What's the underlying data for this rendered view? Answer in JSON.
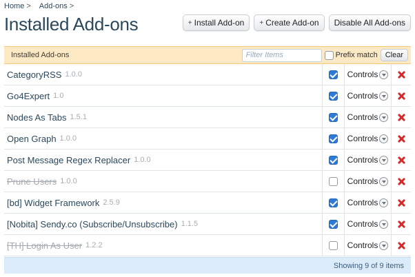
{
  "breadcrumb": [
    {
      "label": "Home",
      "sep": ">"
    },
    {
      "label": "Add-ons",
      "sep": ">"
    }
  ],
  "page_title": "Installed Add-ons",
  "top_buttons": {
    "install": "Install Add-on",
    "create": "Create Add-on",
    "disable_all": "Disable All Add-ons",
    "plus": "+"
  },
  "list_header": {
    "title": "Installed Add-ons",
    "filter_placeholder": "Filter Items",
    "filter_value": "",
    "prefix_match_label": "Prefix match",
    "prefix_match_checked": false,
    "clear_label": "Clear"
  },
  "controls_label": "Controls",
  "addons": [
    {
      "name": "CategoryRSS",
      "version": "1.0.0",
      "enabled": true
    },
    {
      "name": "Go4Expert",
      "version": "1.0",
      "enabled": true
    },
    {
      "name": "Nodes As Tabs",
      "version": "1.5.1",
      "enabled": true
    },
    {
      "name": "Open Graph",
      "version": "1.0.0",
      "enabled": true
    },
    {
      "name": "Post Message Regex Replacer",
      "version": "1.0.0",
      "enabled": true
    },
    {
      "name": "Prune Users",
      "version": "1.0.0",
      "enabled": false
    },
    {
      "name": "[bd] Widget Framework",
      "version": "2.5.9",
      "enabled": true
    },
    {
      "name": "[Nobita] Sendy.co (Subscribe/Unsubscribe)",
      "version": "1.1.5",
      "enabled": true
    },
    {
      "name": "[TH] Login As User",
      "version": "1.2.2",
      "enabled": false
    }
  ],
  "footer_text": "Showing 9 of 9 items",
  "colors": {
    "header_bg": "#fde9c3",
    "footer_bg": "#dcebf9",
    "checkbox_on": "#2e7ad4",
    "delete_red": "#d42a2a",
    "link_text": "#2b485c"
  }
}
